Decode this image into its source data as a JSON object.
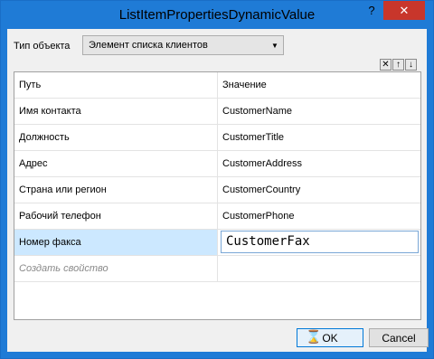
{
  "window": {
    "title": "ListItemPropertiesDynamicValue"
  },
  "titlebar": {
    "help_glyph": "?",
    "close_glyph": "✕"
  },
  "form": {
    "type_label": "Тип объекта",
    "type_value": "Элемент списка клиентов",
    "toolbar": {
      "delete_glyph": "✕",
      "up_glyph": "↑",
      "down_glyph": "↓"
    }
  },
  "grid": {
    "headers": {
      "path": "Путь",
      "value": "Значение"
    },
    "rows": [
      {
        "path": "Имя контакта",
        "value": "CustomerName"
      },
      {
        "path": "Должность",
        "value": "CustomerTitle"
      },
      {
        "path": "Адрес",
        "value": "CustomerAddress"
      },
      {
        "path": "Страна или регион",
        "value": "CustomerCountry"
      },
      {
        "path": "Рабочий телефон",
        "value": "CustomerPhone"
      },
      {
        "path": "Номер факса",
        "value": "CustomerFax"
      }
    ],
    "new_row_placeholder": "Создать свойство",
    "selected_index": 5
  },
  "buttons": {
    "ok": "OK",
    "cancel": "Cancel"
  },
  "colors": {
    "accent": "#1f7bd6",
    "close": "#c8362b",
    "selection": "#cce8ff"
  },
  "cursor_icon": "hourglass-icon"
}
